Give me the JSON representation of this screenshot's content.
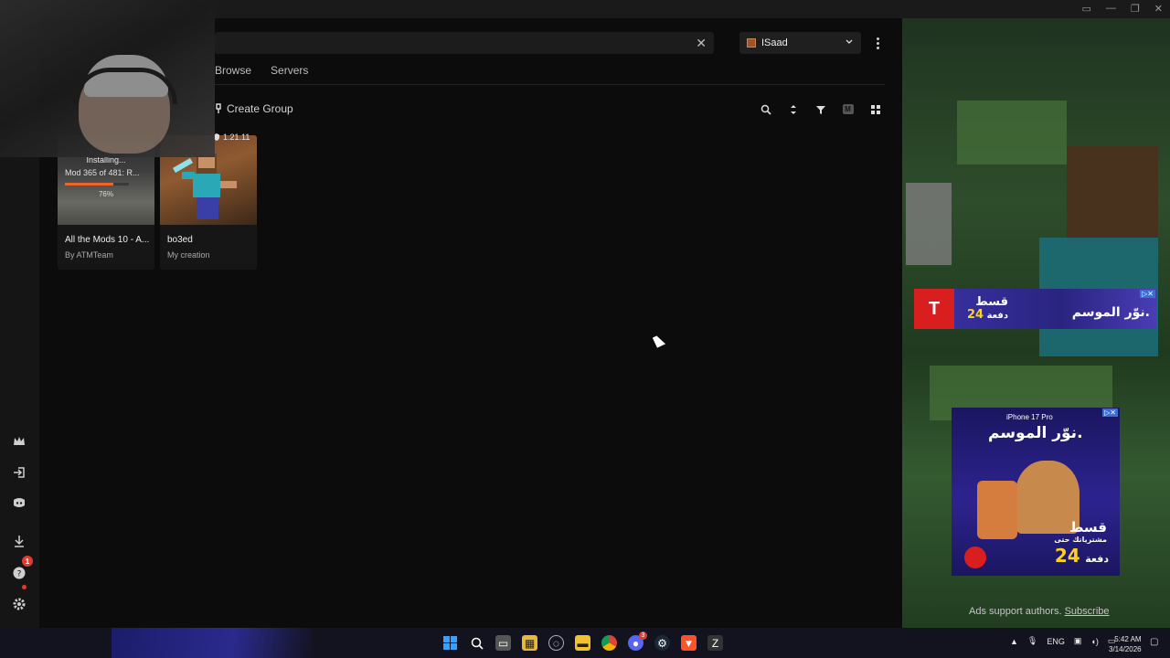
{
  "search": {
    "value": "",
    "clear_icon": "close-icon"
  },
  "account": {
    "name": "ISaad"
  },
  "tabs": [
    "Browse",
    "Servers"
  ],
  "toolbar": {
    "create_group": "Create Group",
    "view_mode_label": "M"
  },
  "instances": [
    {
      "title": "All the Mods 10 - A...",
      "subtitle": "By ATMTeam",
      "status": "Installing...",
      "mod_progress": "Mod 365 of 481: R...",
      "percent_label": "76%",
      "progress_fraction": 0.76
    },
    {
      "title": "bo3ed",
      "subtitle": "My creation",
      "version": "1.21.11"
    }
  ],
  "rail_badge": "1",
  "ads": {
    "banner_text_1": "قسط",
    "banner_text_2": "نوّر الموسم.",
    "banner_number": "24",
    "banner_small": "دفعة",
    "square_header": "iPhone 17 Pro",
    "square_title": "نوّر الموسم.",
    "square_cta": "قسط",
    "square_sub": "مشترياتك حتى",
    "square_number": "24",
    "square_small": "دفعة",
    "support_text": "Ads support authors.",
    "subscribe_link": "Subscribe"
  },
  "taskbar": {
    "tray_lang": "ENG",
    "time": "5:42 AM",
    "date": "3/14/2026",
    "discord_badge": "3"
  },
  "colors": {
    "accent": "#f0642c",
    "badge": "#e03b2f",
    "bg": "#0c0c0c"
  }
}
